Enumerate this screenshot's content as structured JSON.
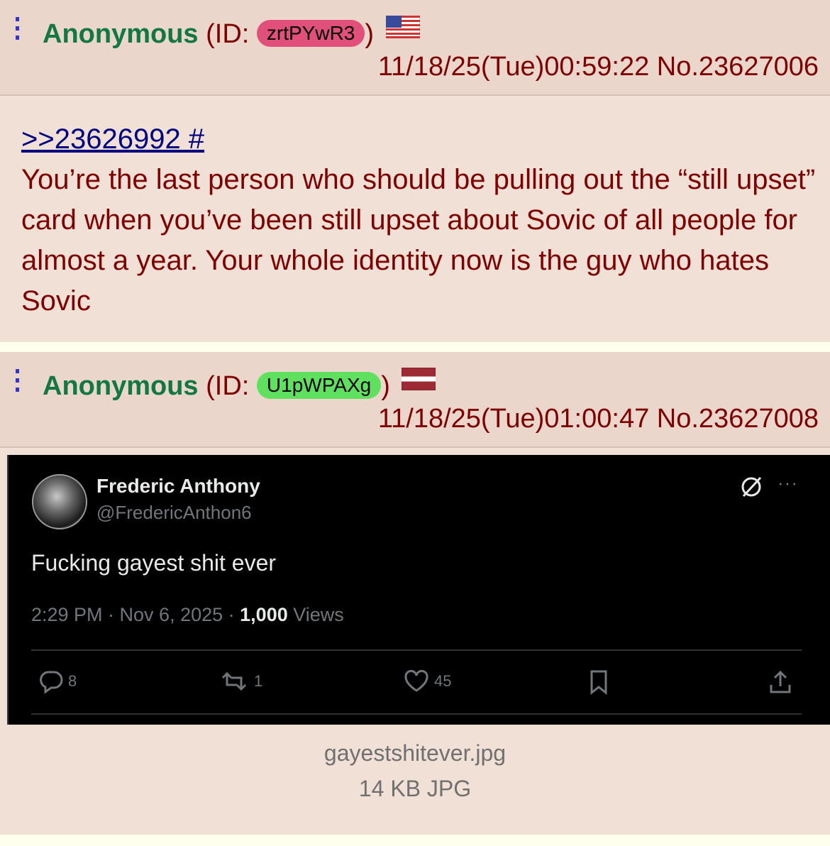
{
  "posts": [
    {
      "name": "Anonymous",
      "id_prefix": "(ID:",
      "id": "zrtPYwR3",
      "id_suffix": ")",
      "id_color": "#e0507a",
      "flag": "us-flag-icon",
      "datetime": "11/18/25(Tue)00:59:22",
      "number": "No.23627006",
      "quote_link": ">>23626992 #",
      "comment": "You’re the last person who should be pulling out the “still upset” card when you’ve been still upset about Sovic of all people for almost a year. Your whole identity now is the guy who hates Sovic"
    },
    {
      "name": "Anonymous",
      "id_prefix": "(ID:",
      "id": "U1pWPAXg",
      "id_suffix": ")",
      "id_color": "#5fe05f",
      "flag": "latvia-flag-icon",
      "datetime": "11/18/25(Tue)01:00:47",
      "number": "No.23627008",
      "tweet": {
        "display_name": "Frederic Anthony",
        "handle": "@FredericAnthon6",
        "text": "Fucking gayest shit ever",
        "timestamp": "2:29 PM · Nov 6, 2025 ·",
        "views_count": "1,000",
        "views_label": "Views",
        "replies": "8",
        "reposts": "1",
        "likes": "45"
      },
      "file_name": "gayestshitever.jpg",
      "file_info": "14 KB JPG"
    }
  ]
}
